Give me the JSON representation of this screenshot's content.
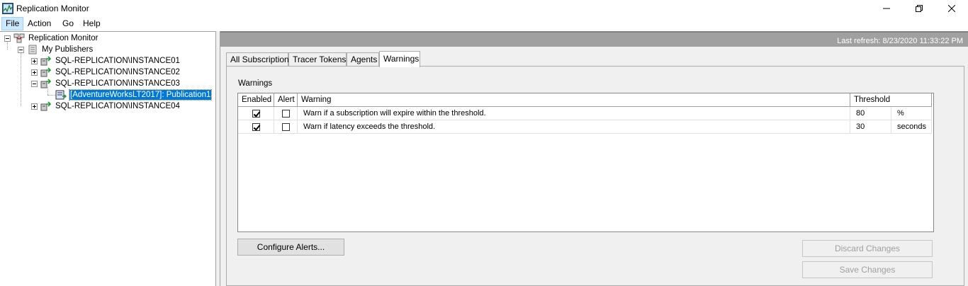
{
  "window": {
    "title": "Replication Monitor",
    "controls": {
      "minimize": "minimize-icon",
      "maximize": "maximize-icon",
      "close": "close-icon"
    }
  },
  "menu": {
    "items": [
      {
        "label": "File",
        "active": true
      },
      {
        "label": "Action"
      },
      {
        "label": "Go"
      },
      {
        "label": "Help"
      }
    ]
  },
  "tree": {
    "root": "Replication Monitor",
    "publishers": "My Publishers",
    "instances": [
      {
        "label": "SQL-REPLICATION\\INSTANCE01"
      },
      {
        "label": "SQL-REPLICATION\\INSTANCE02"
      },
      {
        "label": "SQL-REPLICATION\\INSTANCE03"
      },
      {
        "label": "SQL-REPLICATION\\INSTANCE04"
      }
    ],
    "publication": "[AdventureWorksLT2017]: Publication1"
  },
  "status": {
    "last_refresh": "Last refresh: 8/23/2020 11:33:22 PM"
  },
  "tabs": [
    {
      "label": "All Subscriptions"
    },
    {
      "label": "Tracer Tokens"
    },
    {
      "label": "Agents"
    },
    {
      "label": "Warnings",
      "active": true
    }
  ],
  "warnings": {
    "section_label": "Warnings",
    "columns": [
      "Enabled",
      "Alert",
      "Warning",
      "Threshold"
    ],
    "rows": [
      {
        "enabled": true,
        "alert": false,
        "warning": "Warn if a subscription will expire within the threshold.",
        "threshold": "80",
        "unit": "%"
      },
      {
        "enabled": true,
        "alert": false,
        "warning": "Warn if latency exceeds the threshold.",
        "threshold": "30",
        "unit": "seconds"
      }
    ]
  },
  "buttons": {
    "configure_alerts": "Configure Alerts...",
    "discard_changes": "Discard Changes",
    "save_changes": "Save Changes"
  },
  "colors": {
    "selection": "#0078d7",
    "refresh_bar": "#a0a0a0"
  }
}
